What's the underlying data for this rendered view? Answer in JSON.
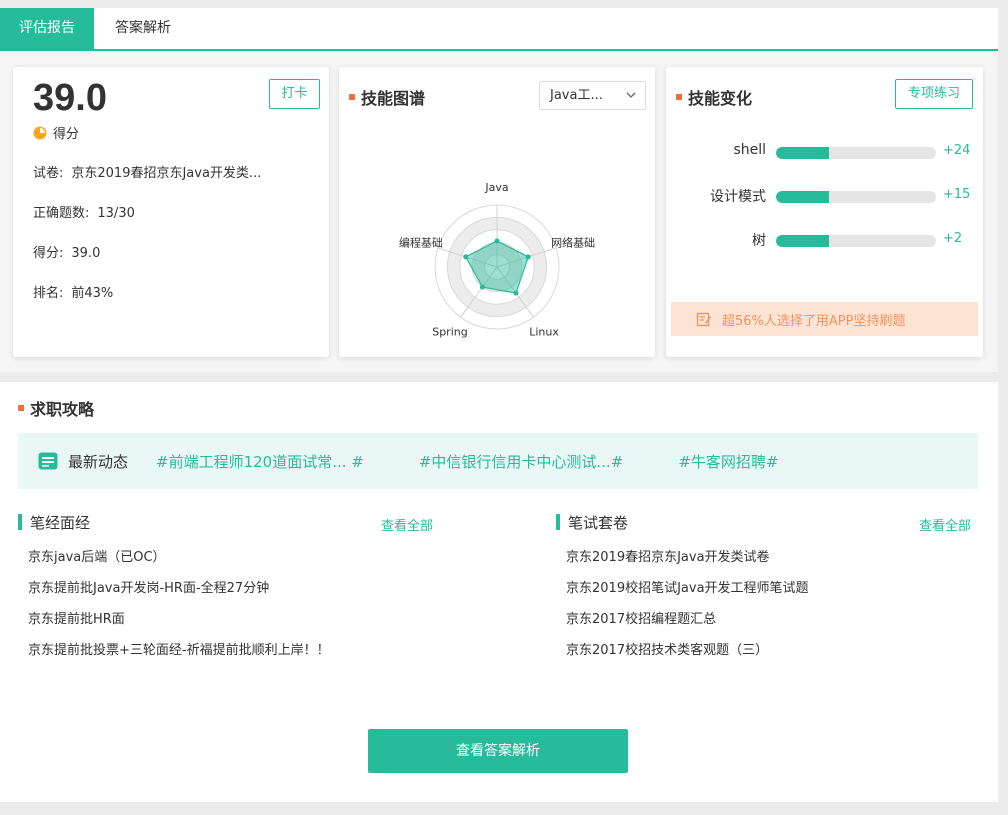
{
  "tabs": [
    {
      "label": "评估报告",
      "active": true
    },
    {
      "label": "答案解析",
      "active": false
    }
  ],
  "score_card": {
    "score": "39.0",
    "score_label": "得分",
    "checkin_button": "打卡",
    "rows": [
      {
        "label": "试卷:",
        "value": "京东2019春招京东Java开发类..."
      },
      {
        "label": "正确题数:",
        "value": "13/30"
      },
      {
        "label": "得分:",
        "value": "39.0"
      },
      {
        "label": "排名:",
        "value": "前43%"
      }
    ]
  },
  "skill_map": {
    "title": "技能图谱",
    "select_value": "Java工...",
    "axes": [
      "Java",
      "网络基础",
      "Linux",
      "Spring",
      "编程基础"
    ],
    "values": [
      0.42,
      0.53,
      0.52,
      0.4,
      0.53
    ]
  },
  "skill_change": {
    "title": "技能变化",
    "practice_button": "专项练习",
    "skills": [
      {
        "name": "shell",
        "level": 0.33,
        "delta": "+24"
      },
      {
        "name": "设计模式",
        "level": 0.33,
        "delta": "+15"
      },
      {
        "name": "树",
        "level": 0.33,
        "delta": "+2"
      }
    ],
    "promo": "超56%人选择了用APP坚持刷题"
  },
  "job_guide": {
    "title": "求职攻略",
    "news_label": "最新动态",
    "news_tags": [
      "#前端工程师120道面试常... #",
      "#中信银行信用卡中心测试...#",
      "#牛客网招聘#"
    ],
    "left": {
      "title": "笔经面经",
      "more": "查看全部",
      "items": [
        "京东java后端（已OC）",
        "京东提前批Java开发岗-HR面-全程27分钟",
        "京东提前批HR面",
        "京东提前批投票+三轮面经-祈福提前批顺利上岸！！"
      ]
    },
    "right": {
      "title": "笔试套卷",
      "more": "查看全部",
      "items": [
        "京东2019春招京东Java开发类试卷",
        "京东2019校招笔试Java开发工程师笔试题",
        "京东2017校招编程题汇总",
        "京东2017校招技术类客观题（三）"
      ]
    }
  },
  "view_answers_button": "查看答案解析",
  "colors": {
    "accent": "#25bb9b",
    "title_marker": "#f26d3d",
    "promo_bg": "#fde3d3",
    "promo_text": "#f0925d"
  }
}
